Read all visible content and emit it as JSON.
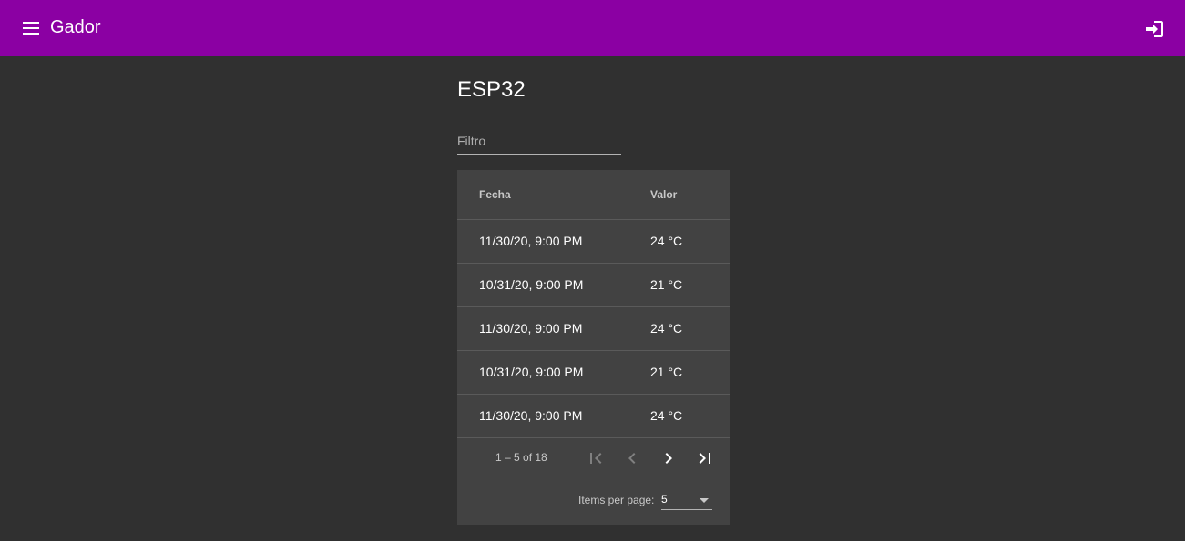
{
  "toolbar": {
    "app_title": "Gador",
    "menu_icon": "menu-icon",
    "login_icon": "login-icon",
    "background_color": "#8b00a3"
  },
  "page": {
    "title": "ESP32"
  },
  "filter": {
    "placeholder": "Filtro",
    "value": ""
  },
  "table": {
    "headers": {
      "fecha": "Fecha",
      "valor": "Valor"
    },
    "rows": [
      {
        "fecha": "11/30/20, 9:00 PM",
        "valor": "24 °C"
      },
      {
        "fecha": "10/31/20, 9:00 PM",
        "valor": "21 °C"
      },
      {
        "fecha": "11/30/20, 9:00 PM",
        "valor": "24 °C"
      },
      {
        "fecha": "10/31/20, 9:00 PM",
        "valor": "21 °C"
      },
      {
        "fecha": "11/30/20, 9:00 PM",
        "valor": "24 °C"
      }
    ]
  },
  "paginator": {
    "range_label": "1 – 5 of 18",
    "items_per_page_label": "Items per page:",
    "items_per_page_value": "5",
    "first_icon": "first-page-icon",
    "prev_icon": "chevron-left-icon",
    "next_icon": "chevron-right-icon",
    "last_icon": "last-page-icon"
  }
}
